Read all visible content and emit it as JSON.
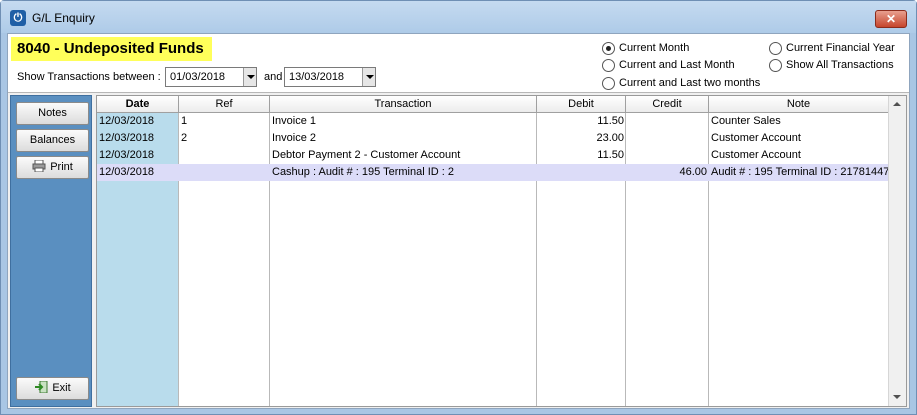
{
  "window": {
    "title": "G/L Enquiry",
    "close_symbol": "✕",
    "app_icon": "power-icon"
  },
  "header": {
    "account_title": "8040 - Undeposited Funds",
    "show_label": "Show Transactions between :",
    "from_date": "01/03/2018",
    "and_label": "and",
    "to_date": "13/03/2018",
    "highlight_color": "#ffff5a"
  },
  "period_options": [
    {
      "label": "Current Month",
      "selected": true
    },
    {
      "label": "Current and Last Month",
      "selected": false
    },
    {
      "label": "Current and Last two months",
      "selected": false
    },
    {
      "label": "Current Financial Year",
      "selected": false
    },
    {
      "label": "Show All Transactions",
      "selected": false
    }
  ],
  "sidebar": {
    "notes_label": "Notes",
    "balances_label": "Balances",
    "print_label": "Print",
    "print_icon": "printer-icon",
    "exit_label": "Exit",
    "exit_icon": "exit-icon",
    "color": "#5a8fc0"
  },
  "table": {
    "columns": [
      "Date",
      "Ref",
      "Transaction",
      "Debit",
      "Credit",
      "Note"
    ],
    "selected_row_color": "#dcdcf8",
    "date_column_color": "#b9dcec",
    "rows": [
      {
        "date": "12/03/2018",
        "ref": "1",
        "transaction": "Invoice 1",
        "debit": "11.50",
        "credit": "",
        "note": "Counter Sales"
      },
      {
        "date": "12/03/2018",
        "ref": "2",
        "transaction": "Invoice 2",
        "debit": "23.00",
        "credit": "",
        "note": "Customer Account"
      },
      {
        "date": "12/03/2018",
        "ref": "",
        "transaction": "Debtor Payment 2 - Customer Account",
        "debit": "11.50",
        "credit": "",
        "note": "Customer Account"
      },
      {
        "date": "12/03/2018",
        "ref": "",
        "transaction": "Cashup : Audit # : 195   Terminal ID : 2",
        "debit": "",
        "credit": "46.00",
        "note": "Audit # : 195   Terminal ID : 21781447"
      }
    ]
  }
}
